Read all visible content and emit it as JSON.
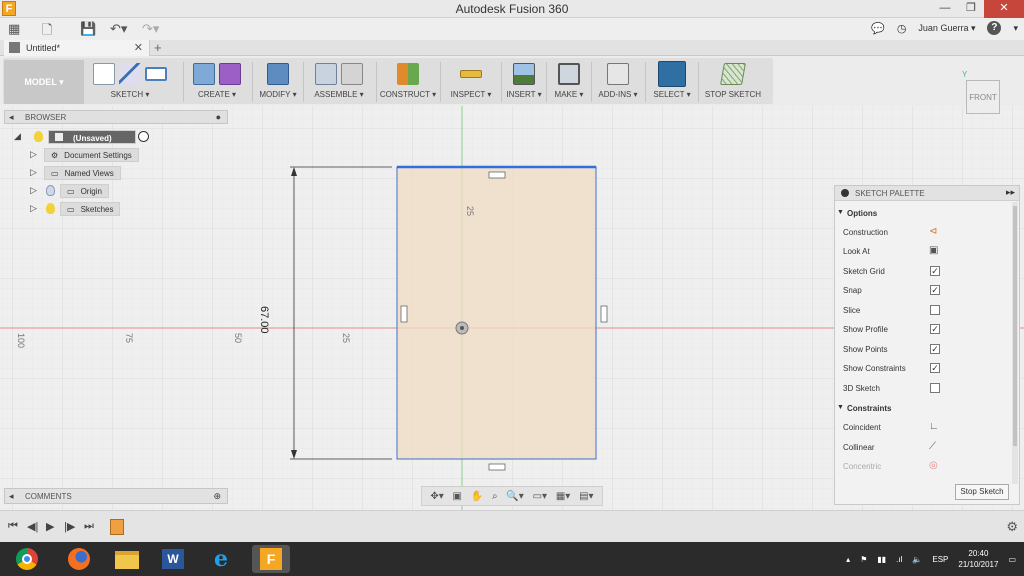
{
  "window": {
    "title": "Autodesk Fusion 360",
    "logo_letter": "F"
  },
  "quickbar": {
    "user": "Juan Guerra ▾",
    "help": "?"
  },
  "tab": {
    "label": "Untitled*",
    "close": "✕",
    "new": "+"
  },
  "ribbon": {
    "workspace": "MODEL ▾",
    "groups": {
      "sketch": "SKETCH ▾",
      "create": "CREATE ▾",
      "modify": "MODIFY ▾",
      "assemble": "ASSEMBLE ▾",
      "construct": "CONSTRUCT ▾",
      "inspect": "INSPECT ▾",
      "insert": "INSERT ▾",
      "make": "MAKE ▾",
      "addins": "ADD-INS ▾",
      "select": "SELECT ▾",
      "stop": "STOP SKETCH"
    }
  },
  "browser": {
    "header": "BROWSER",
    "root": "(Unsaved)",
    "items": [
      "Document Settings",
      "Named Views",
      "Origin",
      "Sketches"
    ]
  },
  "comments": {
    "header": "COMMENTS"
  },
  "canvas": {
    "dimension": "67.00",
    "ruler": {
      "h": [
        "100",
        "75",
        "50",
        "25"
      ],
      "v": [
        "25"
      ]
    },
    "viewcube": "FRONT"
  },
  "palette": {
    "header": "SKETCH PALETTE",
    "options_title": "Options",
    "options": [
      {
        "label": "Construction",
        "type": "icon",
        "icon": "construction-icon"
      },
      {
        "label": "Look At",
        "type": "icon",
        "icon": "look-at-icon"
      },
      {
        "label": "Sketch Grid",
        "type": "check",
        "checked": true
      },
      {
        "label": "Snap",
        "type": "check",
        "checked": true
      },
      {
        "label": "Slice",
        "type": "check",
        "checked": false
      },
      {
        "label": "Show Profile",
        "type": "check",
        "checked": true
      },
      {
        "label": "Show Points",
        "type": "check",
        "checked": true
      },
      {
        "label": "Show Constraints",
        "type": "check",
        "checked": true
      },
      {
        "label": "3D Sketch",
        "type": "check",
        "checked": false
      }
    ],
    "constraints_title": "Constraints",
    "constraints": [
      {
        "label": "Coincident"
      },
      {
        "label": "Collinear"
      },
      {
        "label": "Concentric"
      }
    ],
    "stop_button": "Stop Sketch"
  },
  "taskbar": {
    "lang": "ESP",
    "time": "20:40",
    "date": "21/10/2017"
  }
}
